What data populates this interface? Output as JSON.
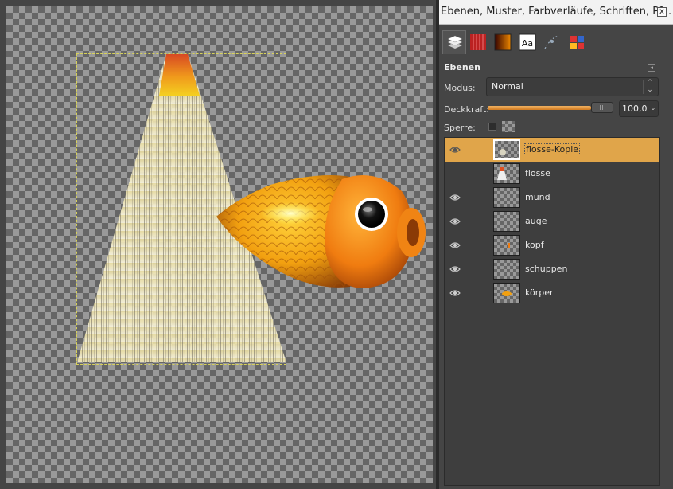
{
  "dock": {
    "title": "Ebenen, Muster, Farbverläufe, Schriften, Pf...",
    "close_label": "x",
    "panel_title": "Ebenen",
    "mode_label": "Modus:",
    "mode_value": "Normal",
    "opacity_label": "Deckkraft:",
    "opacity_value": "100,0",
    "opacity_fraction": 1.0,
    "lock_label": "Sperre:"
  },
  "tabs": [
    {
      "name": "layers-tab-icon",
      "active": true
    },
    {
      "name": "patterns-tab-icon",
      "active": false
    },
    {
      "name": "gradients-tab-icon",
      "active": false
    },
    {
      "name": "fonts-tab-icon",
      "active": false,
      "text": "Aa"
    },
    {
      "name": "paths-tab-icon",
      "active": false
    },
    {
      "name": "colors-tab-icon",
      "active": false
    }
  ],
  "layers": [
    {
      "name": "flosse-Kopie",
      "visible": true,
      "selected": true
    },
    {
      "name": "flosse",
      "visible": false,
      "selected": false
    },
    {
      "name": "mund",
      "visible": true,
      "selected": false
    },
    {
      "name": "auge",
      "visible": true,
      "selected": false
    },
    {
      "name": "kopf",
      "visible": true,
      "selected": false
    },
    {
      "name": "schuppen",
      "visible": true,
      "selected": false
    },
    {
      "name": "körper",
      "visible": true,
      "selected": false
    }
  ],
  "colors": {
    "selection": "#e0a54a",
    "fish_orange": "#f29b12",
    "slider_fill": "#e08a30"
  }
}
